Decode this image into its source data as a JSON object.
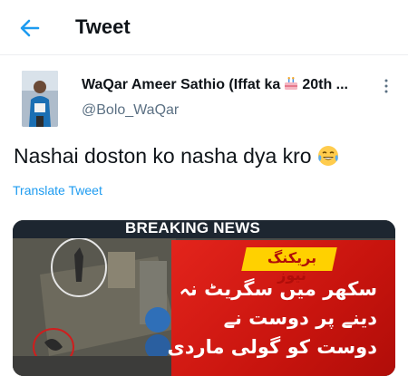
{
  "header": {
    "title": "Tweet",
    "back_icon": "arrow-left-icon",
    "accent": "#1d9bf0"
  },
  "author": {
    "display_name_start": "WaQar Ameer Sathio (Iffat ka",
    "display_name_end": "20th ...",
    "name_emoji": "birthday-cake-icon",
    "handle": "@Bolo_WaQar"
  },
  "tweet": {
    "text": "Nashai doston ko nasha dya kro",
    "emoji": "tears-of-joy-icon",
    "translate_label": "Translate Tweet"
  },
  "media": {
    "banner": "BREAKING NEWS",
    "badge": "بریکنگ نیوز",
    "lines": [
      "سکھر میں سگریٹ نہ",
      "دینے پر دوست نے",
      "دوست کو گولی ماردی"
    ],
    "panel_color": "#d81a12"
  }
}
